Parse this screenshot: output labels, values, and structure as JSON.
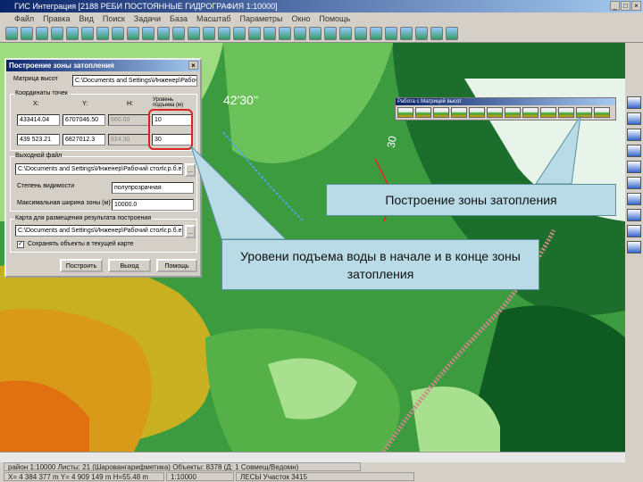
{
  "window": {
    "title": "ГИС Интеграция  [2188  РЕБИ ПОСТОЯННЫЕ  ГИДРОГРАФИЯ  1:10000]"
  },
  "menu": [
    "Файл",
    "Правка",
    "Вид",
    "Поиск",
    "Задачи",
    "База",
    "Масштаб",
    "Параметры",
    "Окно",
    "Помощь"
  ],
  "map": {
    "label_contour": "42'30''",
    "label_30": "30"
  },
  "map_toolbar": {
    "title": "Работа с Матрицей высот"
  },
  "dialog": {
    "title": "Построение зоны затопления",
    "matrix_label": "Матрица высот",
    "matrix_value": "C:\\Documents and Settings\\Инженер\\Рабочий",
    "coords_group": "Координаты точек",
    "col_x": "X:",
    "col_y": "Y:",
    "col_h": "H:",
    "col_level": "Уровень подъема (м)",
    "rows": [
      {
        "x": "433414.04",
        "y": "6707046.50",
        "h": "560.00",
        "level": "10"
      },
      {
        "x": "439 523.21",
        "y": "6827012.3",
        "h": "614.30",
        "level": "30"
      }
    ],
    "output_group": "Выходной файл",
    "output_value": "C:\\Documents and Settings\\Инженер\\Рабочий стол\\г.р.б.е",
    "visibility_label": "Степень видимости",
    "visibility_value": "полупрозрачная",
    "maxwidth_label": "Максимальная ширина зоны (м)",
    "maxwidth_value": "10000.0",
    "map_group": "Карта для размещения результата построения",
    "map_value": "C:\\Documents and Settings\\Инженер\\Рабочий стол\\г.р.б.е",
    "checkbox_label": "Сохранять объекты в текущей карте",
    "btn_build": "Построить",
    "btn_exit": "Выход",
    "btn_help": "Помощь",
    "browse": "..."
  },
  "callouts": {
    "one": "Построение зоны затопления",
    "two": "Уровени подъема воды в начале и в конце зоны затопления"
  },
  "status": {
    "s1": "район  1:10000  Листы: 21 (Шаровангарифметика)  Объекты: 8378 (Д: 1 Совмещ/Ведомн)",
    "s2": "X= 4 384 377 m  Y= 4 909 149 m  H=55.48 m",
    "s3": "1:10000",
    "s4": "ЛЕСЫ Участок 3415"
  }
}
